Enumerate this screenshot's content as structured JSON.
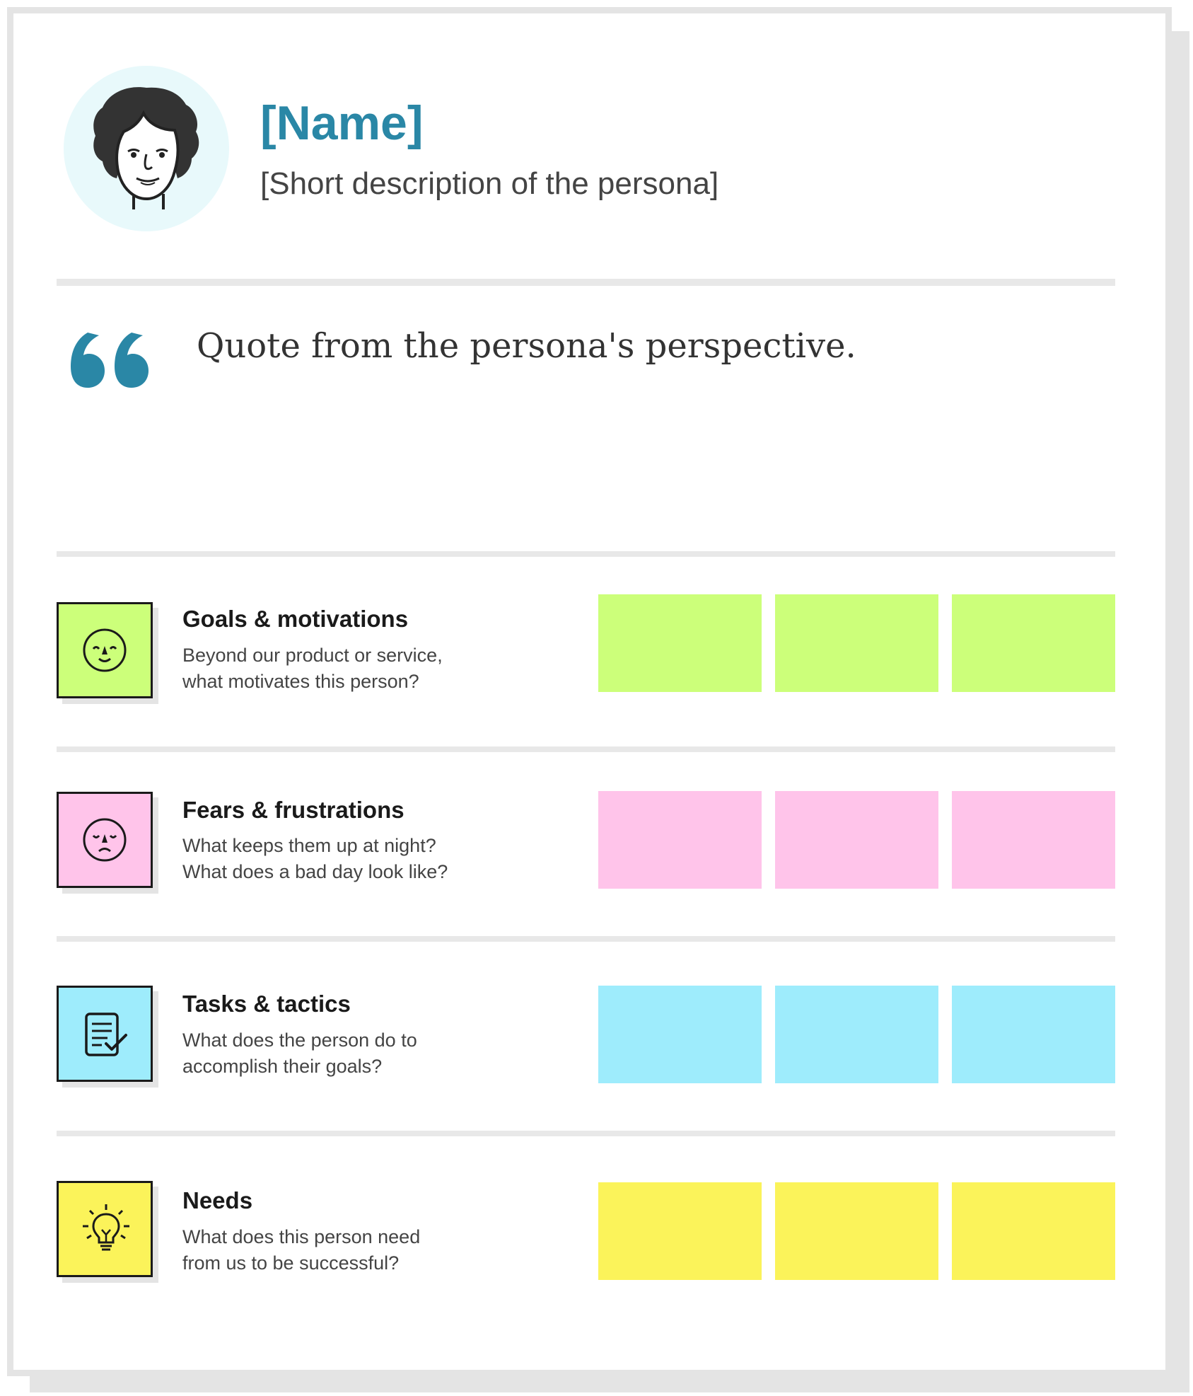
{
  "persona": {
    "name": "[Name]",
    "description": "[Short description of the persona]",
    "avatar_icon": "woman-face-icon",
    "quote": "Quote from the persona's perspective.",
    "quote_icon": "quote-mark-icon",
    "accent_color": "#2a87a6"
  },
  "sections": [
    {
      "title": "Goals & motivations",
      "description_lines": [
        "Beyond our product or service,",
        "what motivates this person?"
      ],
      "icon": "happy-face-icon",
      "color": "#ccff7a",
      "sticky_notes": 3
    },
    {
      "title": "Fears & frustrations",
      "description_lines": [
        "What keeps them up at night?",
        "What does a bad day look like?"
      ],
      "icon": "sad-face-icon",
      "color": "#ffc4ea",
      "sticky_notes": 3
    },
    {
      "title": "Tasks & tactics",
      "description_lines": [
        "What does the person do to",
        "accomplish their goals?"
      ],
      "icon": "checklist-icon",
      "color": "#9eecfc",
      "sticky_notes": 3
    },
    {
      "title": "Needs",
      "description_lines": [
        "What does this person need",
        "from us to be successful?"
      ],
      "icon": "lightbulb-icon",
      "color": "#fbf35a",
      "sticky_notes": 3
    }
  ]
}
